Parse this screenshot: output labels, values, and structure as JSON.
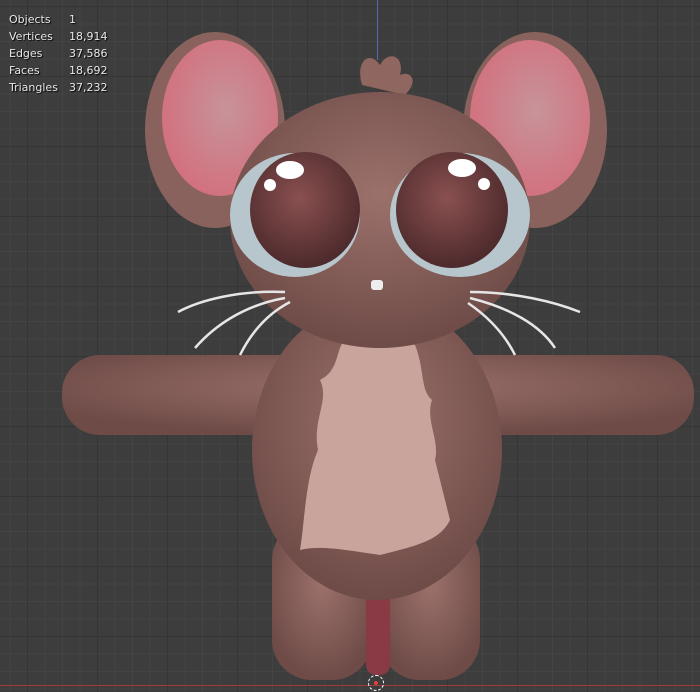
{
  "stats": [
    {
      "label": "Objects",
      "value": "1"
    },
    {
      "label": "Vertices",
      "value": "18,914"
    },
    {
      "label": "Edges",
      "value": "37,586"
    },
    {
      "label": "Faces",
      "value": "18,692"
    },
    {
      "label": "Triangles",
      "value": "37,232"
    }
  ],
  "colors": {
    "body": "#8f6660",
    "belly": "#c9a49c",
    "ear_inner": "#d68e95",
    "eye": "#6a3a3a",
    "grid": "#3d3d3d"
  }
}
